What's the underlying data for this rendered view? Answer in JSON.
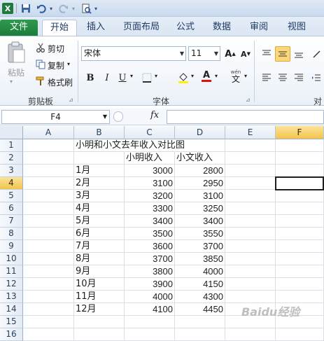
{
  "quick_access": {
    "app_icon": "excel-logo-icon",
    "save_icon": "save-icon",
    "undo_icon": "undo-icon",
    "redo_icon": "redo-icon",
    "preview_icon": "print-preview-icon"
  },
  "tabs": [
    "文件",
    "开始",
    "插入",
    "页面布局",
    "公式",
    "数据",
    "审阅",
    "视图"
  ],
  "active_tab": "开始",
  "ribbon": {
    "clipboard": {
      "paste": "粘贴",
      "cut": "剪切",
      "copy": "复制",
      "format_painter": "格式刷",
      "group_label": "剪贴板"
    },
    "font": {
      "font_name": "宋体",
      "font_size": "11",
      "bold": "B",
      "italic": "I",
      "underline": "U",
      "group_label": "字体",
      "phonetic": "wén"
    },
    "alignment": {
      "group_label": "对"
    }
  },
  "formula_bar": {
    "name_box": "F4",
    "fx": "fx",
    "formula": ""
  },
  "columns": [
    "A",
    "B",
    "C",
    "D",
    "E",
    "F"
  ],
  "selected_column": "F",
  "rows": [
    "1",
    "2",
    "3",
    "4",
    "5",
    "6",
    "7",
    "8",
    "9",
    "10",
    "11",
    "12",
    "13",
    "14",
    "15",
    "16"
  ],
  "selected_row": "4",
  "sheet": {
    "title": "小明和小文去年收入对比图",
    "header_c": "小明收入",
    "header_d": "小文收入",
    "months": [
      "1月",
      "2月",
      "3月",
      "4月",
      "5月",
      "6月",
      "7月",
      "8月",
      "9月",
      "10月",
      "11月",
      "12月"
    ],
    "xiaoming": [
      "3000",
      "3100",
      "3200",
      "3300",
      "3400",
      "3500",
      "3600",
      "3700",
      "3800",
      "3900",
      "4000",
      "4100"
    ],
    "xiaowen": [
      "2800",
      "2950",
      "3100",
      "3250",
      "3400",
      "3550",
      "3700",
      "3850",
      "4000",
      "4150",
      "4300",
      "4450"
    ]
  },
  "watermark": "Baidu经验"
}
